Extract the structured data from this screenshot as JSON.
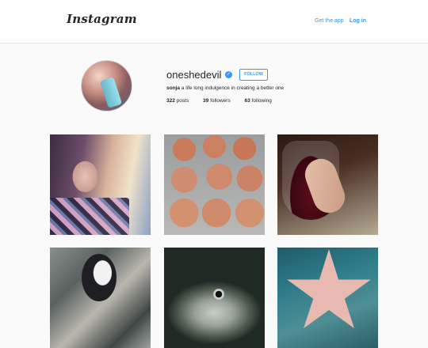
{
  "header": {
    "logo_text": "Instagram",
    "get_app_label": "Get the app",
    "login_label": "Log in"
  },
  "profile": {
    "username": "oneshedevil",
    "follow_label": "FOLLOW",
    "bio_name": "sonja",
    "bio_text": "a life long indulgence in creating a better one",
    "posts_count": "322",
    "posts_label": "posts",
    "followers_count": "39",
    "followers_label": "followers",
    "following_count": "63",
    "following_label": "following"
  },
  "colors": {
    "accent": "#3897f0",
    "background": "#fafafa"
  }
}
